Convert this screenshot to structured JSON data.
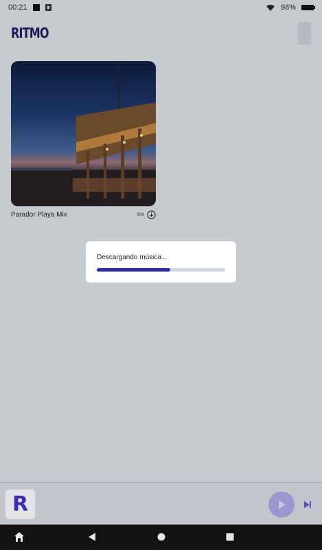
{
  "status": {
    "time": "00:21",
    "battery": "98%"
  },
  "app": {
    "title": "RITMO"
  },
  "playlist": {
    "title": "Parador Playa Mix",
    "progress_label": "6%"
  },
  "dialog": {
    "message": "Descargando música...",
    "progress_fraction": 0.57
  },
  "player": {
    "art_letter": "R"
  },
  "colors": {
    "accent": "#2d2aa6",
    "logo": "#1b1a55",
    "play_button": "#9b96cf"
  }
}
